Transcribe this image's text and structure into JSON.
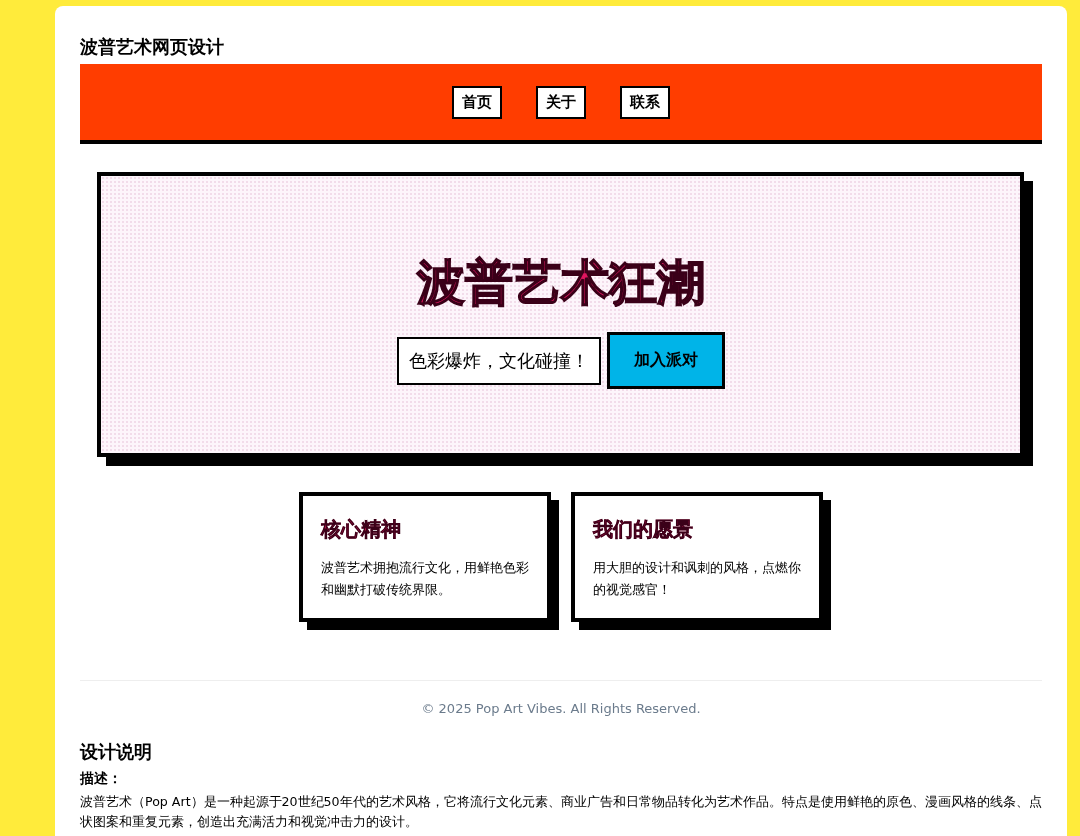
{
  "page_title": "波普艺术网页设计",
  "nav": [
    {
      "label": "首页"
    },
    {
      "label": "关于"
    },
    {
      "label": "联系"
    }
  ],
  "hero": {
    "heading": "波普艺术狂潮",
    "tagline": "色彩爆炸，文化碰撞！",
    "button": "加入派对"
  },
  "cards": [
    {
      "title": "核心精神",
      "text": "波普艺术拥抱流行文化，用鲜艳色彩和幽默打破传统界限。"
    },
    {
      "title": "我们的愿景",
      "text": "用大胆的设计和讽刺的风格，点燃你的视觉感官！"
    }
  ],
  "footer": "© 2025 Pop Art Vibes. All Rights Reserved.",
  "notes": {
    "title": "设计说明",
    "label": "描述：",
    "text": "波普艺术（Pop Art）是一种起源于20世纪50年代的艺术风格，它将流行文化元素、商业广告和日常物品转化为艺术作品。特点是使用鲜艳的原色、漫画风格的线条、点状图案和重复元素，创造出充满活力和视觉冲击力的设计。"
  }
}
